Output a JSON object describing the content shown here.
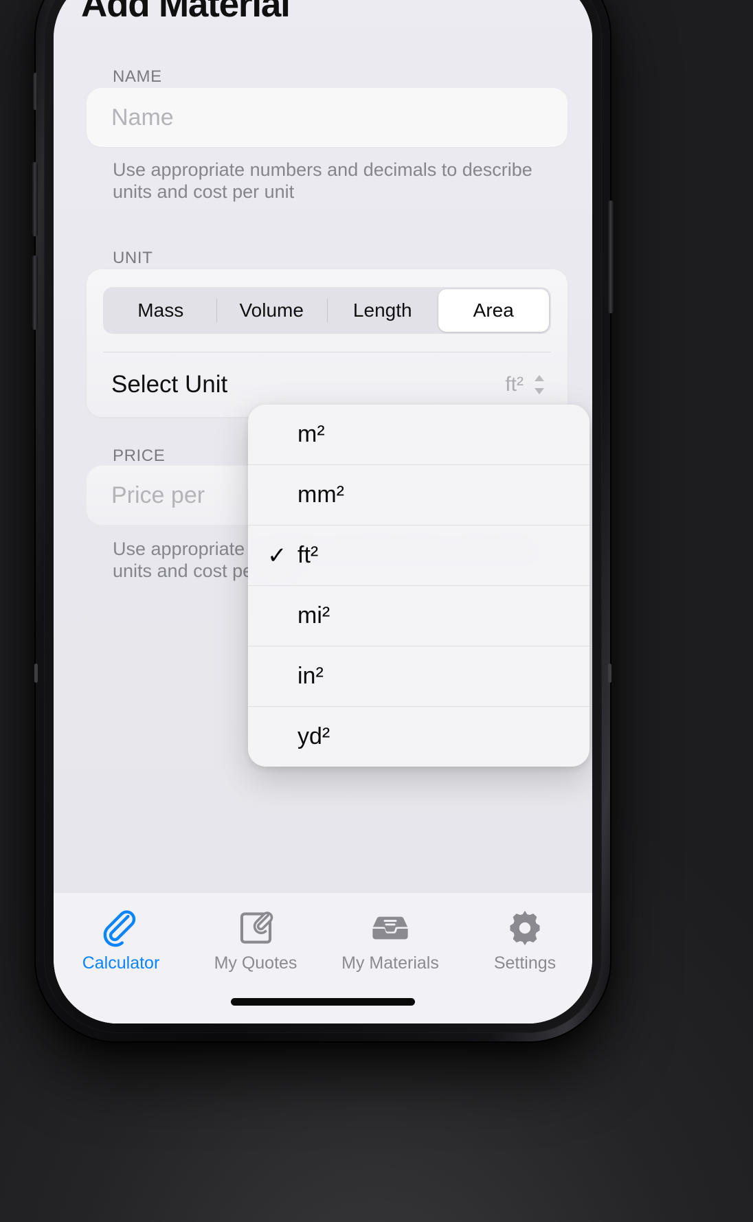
{
  "header": {
    "title": "Add Material"
  },
  "form": {
    "name": {
      "label": "NAME",
      "placeholder": "Name",
      "value": "",
      "helper": "Use appropriate numbers and decimals to describe units and cost per unit"
    },
    "unit": {
      "label": "UNIT",
      "segments": [
        "Mass",
        "Volume",
        "Length",
        "Area"
      ],
      "selected_segment": "Area",
      "select_row_label": "Select Unit",
      "selected_unit": "ft²"
    },
    "price": {
      "label": "PRICE",
      "placeholder": "Price per",
      "value": "",
      "helper": "Use appropriate numbers and decimals to describe units and cost per unit"
    }
  },
  "unit_menu": {
    "open": true,
    "checked": "ft²",
    "items": [
      {
        "label": "m²",
        "checked": false
      },
      {
        "label": "mm²",
        "checked": false
      },
      {
        "label": "ft²",
        "checked": true
      },
      {
        "label": "mi²",
        "checked": false
      },
      {
        "label": "in²",
        "checked": false
      },
      {
        "label": "yd²",
        "checked": false
      }
    ],
    "check_glyph": "✓"
  },
  "tabbar": {
    "active": "Calculator",
    "items": [
      {
        "label": "Calculator",
        "icon": "paperclip-icon",
        "active": true
      },
      {
        "label": "My Quotes",
        "icon": "note-paperclip-icon",
        "active": false
      },
      {
        "label": "My Materials",
        "icon": "tray-icon",
        "active": false
      },
      {
        "label": "Settings",
        "icon": "gear-icon",
        "active": false
      }
    ]
  },
  "colors": {
    "accent": "#0a84ff",
    "inactive": "#8a8a90",
    "screen_bg": "#f1f1f6",
    "field_bg": "#ffffff",
    "menu_bg": "#f4f4f7"
  }
}
